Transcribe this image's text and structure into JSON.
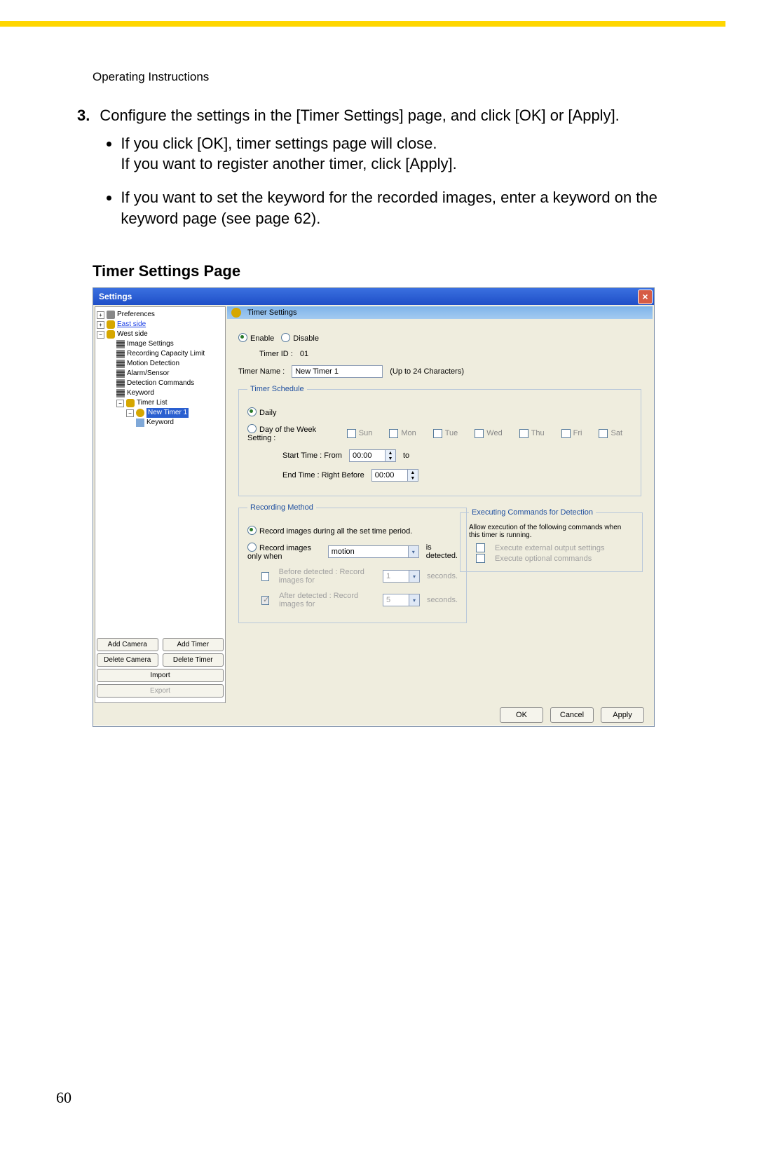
{
  "header": "Operating Instructions",
  "page_number": "60",
  "step": {
    "num": "3.",
    "text": "Configure the settings in the [Timer Settings] page, and click [OK] or [Apply].",
    "bullets": [
      "If you click [OK], timer settings page will close.\nIf you want to register another timer, click [Apply].",
      "If you want to set the keyword for the recorded images, enter a keyword on the keyword page (see page 62)."
    ]
  },
  "section_title": "Timer Settings Page",
  "dialog": {
    "title": "Settings",
    "tree": {
      "preferences": "Preferences",
      "east": "East side",
      "west": "West side",
      "west_children": [
        "Image Settings",
        "Recording Capacity Limit",
        "Motion Detection",
        "Alarm/Sensor",
        "Detection Commands",
        "Keyword"
      ],
      "timer_list": "Timer List",
      "new_timer": "New Timer 1",
      "nt_keyword": "Keyword"
    },
    "side_buttons": {
      "add_cam": "Add Camera",
      "add_tim": "Add Timer",
      "del_cam": "Delete Camera",
      "del_tim": "Delete Timer",
      "import": "Import",
      "export": "Export"
    },
    "panel_title": "Timer Settings",
    "enable": "Enable",
    "disable": "Disable",
    "timer_id_lbl": "Timer ID :",
    "timer_id": "01",
    "timer_name_lbl": "Timer Name :",
    "timer_name": "New Timer 1",
    "name_hint": "(Up to 24 Characters)",
    "schedule": {
      "legend": "Timer Schedule",
      "daily": "Daily",
      "dow": "Day of the Week Setting :",
      "days": [
        "Sun",
        "Mon",
        "Tue",
        "Wed",
        "Thu",
        "Fri",
        "Sat"
      ],
      "start_lbl": "Start Time :  From",
      "start": "00:00",
      "to": "to",
      "end_lbl": "End Time :  Right Before",
      "end": "00:00"
    },
    "recmethod": {
      "legend": "Recording Method",
      "opt1": "Record images during all the set time period.",
      "opt2_pre": "Record images only when",
      "motion": "motion",
      "opt2_post": "is detected.",
      "before": "Before detected :  Record images for",
      "before_v": "1",
      "after": "After   detected :  Record images for",
      "after_v": "5",
      "seconds": "seconds."
    },
    "execcmd": {
      "legend": "Executing Commands for Detection",
      "desc": "Allow execution of the following commands when this timer is running.",
      "c1": "Execute external output settings",
      "c2": "Execute optional commands"
    },
    "footer": {
      "ok": "OK",
      "cancel": "Cancel",
      "apply": "Apply"
    }
  }
}
